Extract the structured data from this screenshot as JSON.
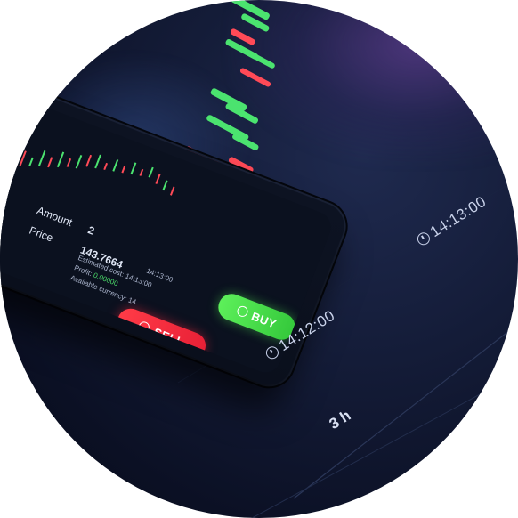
{
  "colors": {
    "background_dark": "#0b1024",
    "candle_green": "#4be36f",
    "candle_red": "#ff4a57",
    "sell_button": "#ff3b47",
    "buy_button": "#4fe24d"
  },
  "trade_panel": {
    "amount_label": "Amount",
    "amount_value": "2",
    "price_label": "Price",
    "price_value": "143.7664",
    "time_value": "14:13:00",
    "estimated_label": "Estimated cost:",
    "estimated_value": "14:13:00",
    "profit_label": "Profit:",
    "profit_value": "0.00000",
    "available_label": "Available currency:",
    "available_value": "14",
    "sell_label": "SELL",
    "buy_label": "BUY",
    "sell_icon": "circle-icon",
    "buy_icon": "circle-icon"
  },
  "timeline": {
    "timestamp_1": "14:12:00",
    "timestamp_2": "14:13:00",
    "period": "3 h",
    "clock_icon": "clock-icon"
  }
}
